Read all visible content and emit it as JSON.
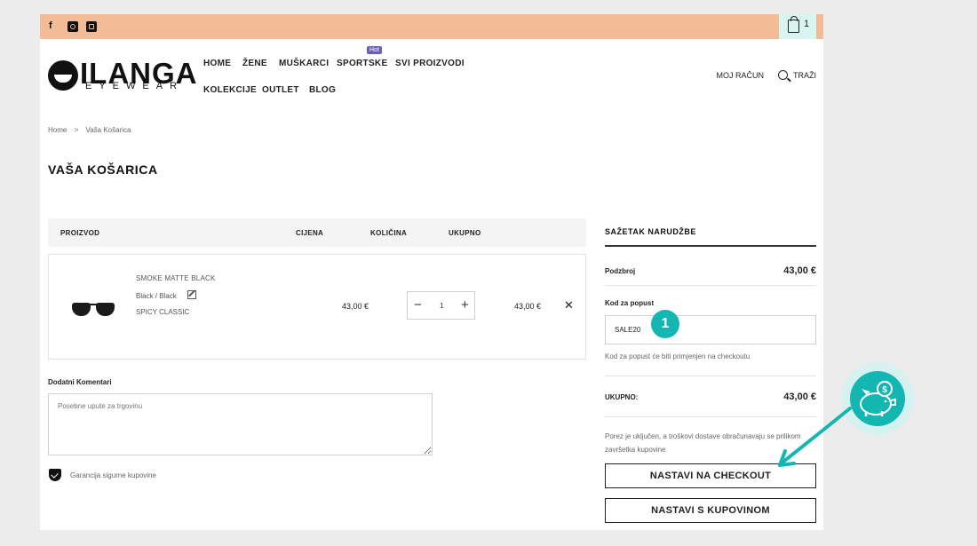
{
  "topbar": {
    "social": [
      "facebook-icon",
      "instagram-icon",
      "tiktok-icon"
    ],
    "cart_count": "1",
    "colors": {
      "bar": "#f4bb97",
      "cart_bg": "#d8f5ef"
    }
  },
  "logo": {
    "name": "ILANGA",
    "sub": "EYEWEAR"
  },
  "nav": {
    "items": [
      "HOME",
      "ŽENE",
      "MUŠKARCI",
      "SPORTSKE",
      "SVI PROIZVODI",
      "KOLEKCIJE",
      "OUTLET",
      "BLOG"
    ],
    "hot_badge": "Hot",
    "account": "MOJ RAČUN",
    "search": "TRAŽI"
  },
  "breadcrumb": {
    "home": "Home",
    "sep": ">",
    "current": "Vaša Košarica"
  },
  "page_title": "VAŠA KOŠARICA",
  "table": {
    "headers": {
      "product": "PROIZVOD",
      "price": "CIJENA",
      "qty": "KOLIČINA",
      "total": "UKUPNO"
    },
    "items": [
      {
        "name": "SMOKE MATTE BLACK",
        "variant": "Black / Black",
        "collection": "SPICY CLASSIC",
        "price": "43,00 €",
        "quantity": "1",
        "total": "43,00 €"
      }
    ]
  },
  "comments": {
    "label": "Dodatni Komentari",
    "placeholder": "Posebne upute za trgovinu"
  },
  "guarantee": "Garancija sigurne kupovine",
  "summary": {
    "title": "SAŽETAK NARUDŽBE",
    "subtotal_label": "Podzbroj",
    "subtotal": "43,00 €",
    "coupon_label": "Kod za popust",
    "coupon_value": "SALE20",
    "coupon_note": "Kod za popust će biti primjenjen na checkoutu",
    "total_label": "UKUPNO:",
    "total": "43,00 €",
    "tax_note": "Porez je uključen, a troškovi dostave obračunavaju se prilikom završetka kupovine",
    "checkout_btn": "NASTAVI NA CHECKOUT",
    "continue_btn": "NASTAVI S KUPOVINOM"
  },
  "overlay": {
    "step_marker": "1",
    "accent": "#14b6b2"
  }
}
